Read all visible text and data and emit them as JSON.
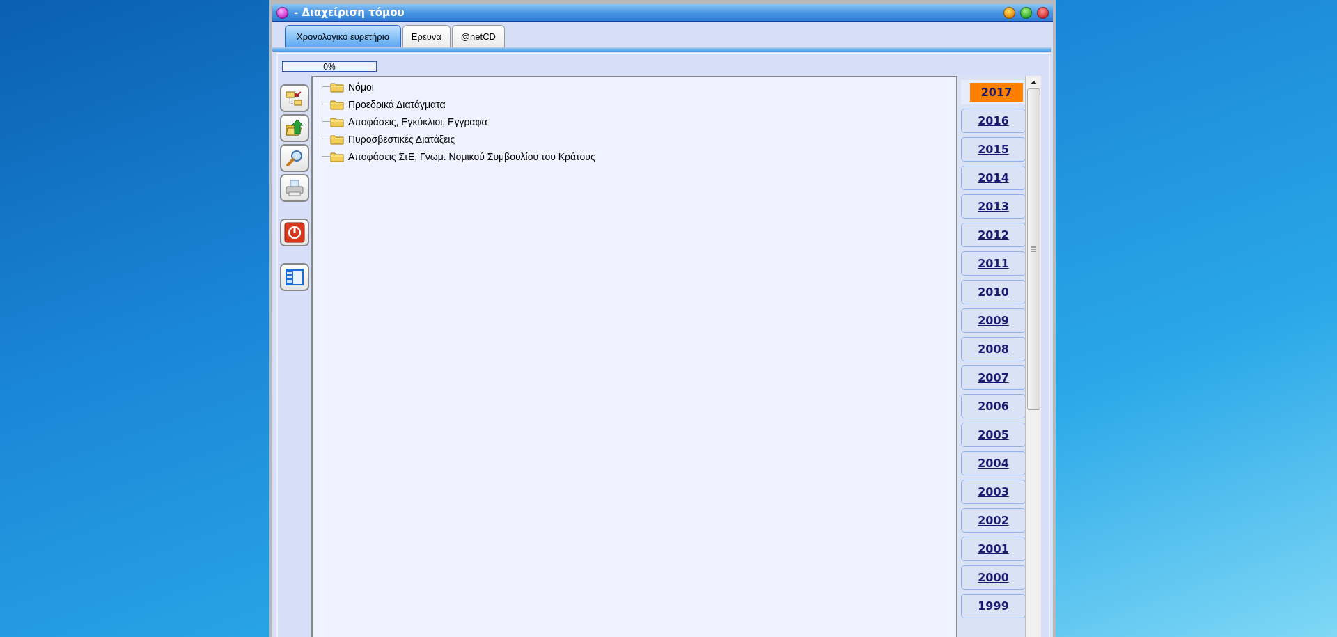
{
  "window": {
    "title": "- Διαχείριση τόμου"
  },
  "tabs": [
    {
      "label": "Χρονολογικό ευρετήριο",
      "selected": true
    },
    {
      "label": "Ερευνα",
      "selected": false
    },
    {
      "label": "@netCD",
      "selected": false
    }
  ],
  "progress": {
    "level": 0,
    "reading": "0%"
  },
  "tree": {
    "items": [
      {
        "label": "Νόμοι"
      },
      {
        "label": "Προεδρικά Διατάγματα"
      },
      {
        "label": "Αποφάσεις, Εγκύκλιοι, Εγγραφα"
      },
      {
        "label": "Πυροσβεστικές Διατάξεις"
      },
      {
        "label": "Αποφάσεις ΣτΕ, Γνωμ. Νομικού Συμβουλίου του Κράτους"
      }
    ]
  },
  "years": [
    {
      "label": "2017",
      "selected": true
    },
    {
      "label": "2016",
      "selected": false
    },
    {
      "label": "2015",
      "selected": false
    },
    {
      "label": "2014",
      "selected": false
    },
    {
      "label": "2013",
      "selected": false
    },
    {
      "label": "2012",
      "selected": false
    },
    {
      "label": "2011",
      "selected": false
    },
    {
      "label": "2010",
      "selected": false
    },
    {
      "label": "2009",
      "selected": false
    },
    {
      "label": "2008",
      "selected": false
    },
    {
      "label": "2007",
      "selected": false
    },
    {
      "label": "2006",
      "selected": false
    },
    {
      "label": "2005",
      "selected": false
    },
    {
      "label": "2004",
      "selected": false
    },
    {
      "label": "2003",
      "selected": false
    },
    {
      "label": "2002",
      "selected": false
    },
    {
      "label": "2001",
      "selected": false
    },
    {
      "label": "2000",
      "selected": false
    },
    {
      "label": "1999",
      "selected": false
    }
  ]
}
